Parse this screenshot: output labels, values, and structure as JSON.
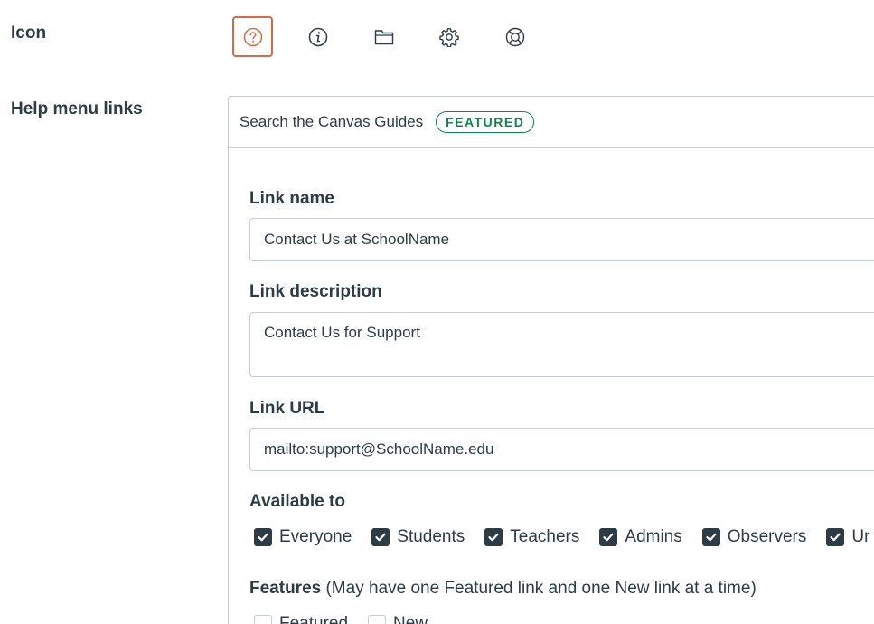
{
  "icon_section": {
    "label": "Icon",
    "icons": [
      "question-icon",
      "info-icon",
      "folder-icon",
      "gear-icon",
      "lifebuoy-icon"
    ],
    "selected": "question-icon",
    "selected_color": "#d26b47"
  },
  "help_links": {
    "label": "Help menu links",
    "header_link": "Search the Canvas Guides",
    "header_badge": "FEATURED",
    "badge_color": "#0b874b"
  },
  "form": {
    "link_name_label": "Link name",
    "link_name_value": "Contact Us at SchoolName",
    "link_description_label": "Link description",
    "link_description_value": "Contact Us for Support",
    "link_url_label": "Link URL",
    "link_url_value": "mailto:support@SchoolName.edu",
    "available_label": "Available to",
    "available": [
      {
        "label": "Everyone",
        "checked": true
      },
      {
        "label": "Students",
        "checked": true
      },
      {
        "label": "Teachers",
        "checked": true
      },
      {
        "label": "Admins",
        "checked": true
      },
      {
        "label": "Observers",
        "checked": true
      },
      {
        "label": "Ur",
        "checked": true
      }
    ],
    "features_label": "Features",
    "features_note": "(May have one Featured link and one New link at a time)",
    "features": [
      {
        "label": "Featured",
        "checked": false
      },
      {
        "label": "New",
        "checked": false
      }
    ]
  }
}
